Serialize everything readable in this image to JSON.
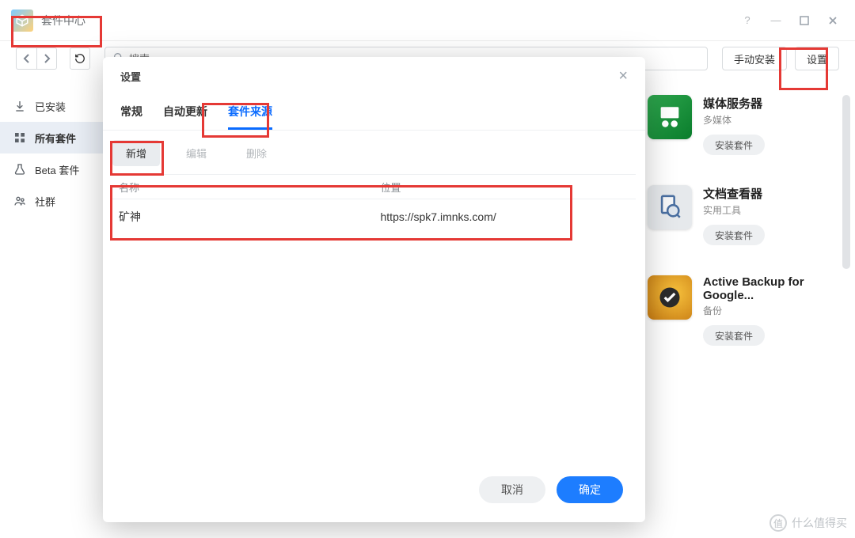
{
  "window": {
    "title": "套件中心"
  },
  "toolbar": {
    "search_placeholder": "搜索",
    "manual_install": "手动安装",
    "settings": "设置"
  },
  "sidebar": {
    "items": [
      {
        "label": "已安装"
      },
      {
        "label": "所有套件"
      },
      {
        "label": "Beta 套件"
      },
      {
        "label": "社群"
      }
    ]
  },
  "apps": [
    {
      "name": "媒体服务器",
      "category": "多媒体",
      "install": "安装套件"
    },
    {
      "name": "文档查看器",
      "category": "实用工具",
      "install": "安装套件"
    },
    {
      "name": "Active Backup for Google...",
      "category": "备份",
      "install": "安装套件"
    }
  ],
  "dialog": {
    "title": "设置",
    "tabs": {
      "general": "常规",
      "autoupdate": "自动更新",
      "sources": "套件来源"
    },
    "toolbar": {
      "add": "新增",
      "edit": "编辑",
      "delete": "删除"
    },
    "columns": {
      "name": "名称",
      "location": "位置"
    },
    "rows": [
      {
        "name": "矿神",
        "location": "https://spk7.imnks.com/"
      }
    ],
    "footer": {
      "cancel": "取消",
      "ok": "确定"
    }
  },
  "watermark": "什么值得买"
}
